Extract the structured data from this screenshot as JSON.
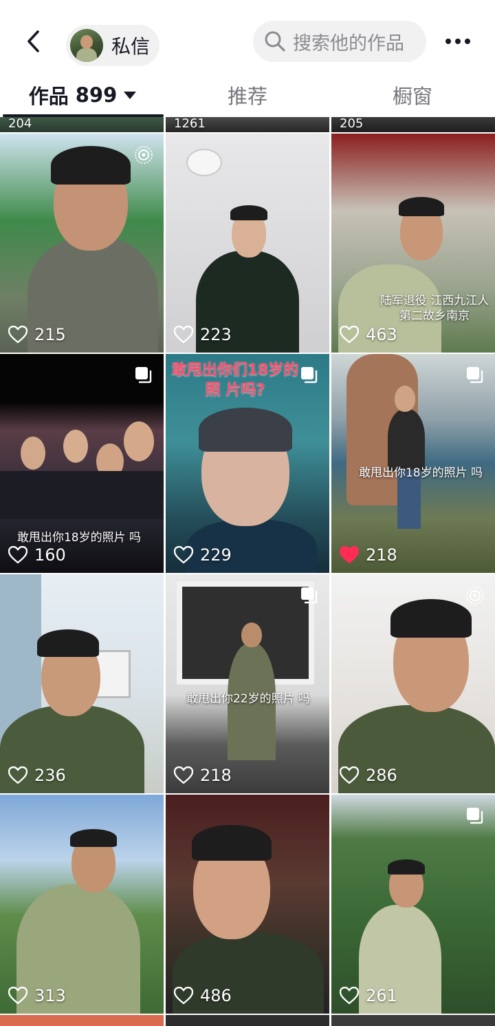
{
  "header": {
    "dm_label": "私信",
    "search_placeholder": "搜索他的作品"
  },
  "tabs": {
    "works_label": "作品",
    "works_count": "899",
    "recommend_label": "推荐",
    "window_label": "橱窗"
  },
  "grid": {
    "top_partial": [
      "204",
      "1261",
      "205"
    ],
    "items": [
      {
        "likes": "215",
        "liked": false,
        "badge": "live",
        "caption": ""
      },
      {
        "likes": "223",
        "liked": false,
        "badge": "",
        "caption": ""
      },
      {
        "likes": "463",
        "liked": false,
        "badge": "",
        "caption": "陆军退役 江西九江人 第二故乡南京"
      },
      {
        "likes": "160",
        "liked": false,
        "badge": "multi",
        "caption": "敢甩出你18岁的照片 吗"
      },
      {
        "likes": "229",
        "liked": false,
        "badge": "multi",
        "caption": "敢甩出你们18岁的照 片吗?"
      },
      {
        "likes": "218",
        "liked": true,
        "badge": "multi",
        "caption": "敢甩出你18岁的照片 吗"
      },
      {
        "likes": "236",
        "liked": false,
        "badge": "",
        "caption": ""
      },
      {
        "likes": "218",
        "liked": false,
        "badge": "multi",
        "caption": "敢甩出你22岁的照片 吗"
      },
      {
        "likes": "286",
        "liked": false,
        "badge": "live",
        "caption": ""
      },
      {
        "likes": "313",
        "liked": false,
        "badge": "",
        "caption": ""
      },
      {
        "likes": "486",
        "liked": false,
        "badge": "",
        "caption": ""
      },
      {
        "likes": "261",
        "liked": false,
        "badge": "multi",
        "caption": ""
      }
    ]
  },
  "colors": {
    "liked_heart": "#fe2c55",
    "text_primary": "#161823",
    "text_secondary": "#75767c",
    "pill_bg": "#f1f1f2"
  },
  "icons": {
    "back": "chevron-left-icon",
    "search": "search-icon",
    "more": "more-dots-icon",
    "like": "heart-icon",
    "multi": "multi-image-icon",
    "live": "live-photo-icon"
  }
}
